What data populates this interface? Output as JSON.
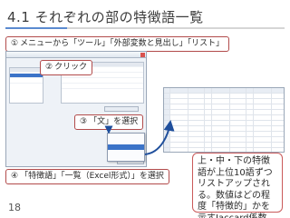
{
  "slide": {
    "title": "4.1 それぞれの部の特徴語一覧",
    "page_number": "18"
  },
  "steps": {
    "step1": {
      "marker": "①",
      "text": "メニューから「ツール」「外部変数と見出し」「リスト」"
    },
    "step2": {
      "marker": "②",
      "text": "クリック"
    },
    "step3": {
      "marker": "③",
      "text": "「文」を選択"
    },
    "step4": {
      "marker": "④",
      "text": "「特徴語」「一覧（Excel形式）」を選択"
    }
  },
  "callout": {
    "text": "上・中・下の特徴語が上位10語ずつリストアップされる。数値はどの程度「特徴的」かを示すJaccard係数。"
  },
  "colors": {
    "accent_red": "#c95a5a",
    "accent_blue": "#3b73c8",
    "title_bar": "#5b8bd0",
    "arrow_blue": "#1f4f9c"
  }
}
